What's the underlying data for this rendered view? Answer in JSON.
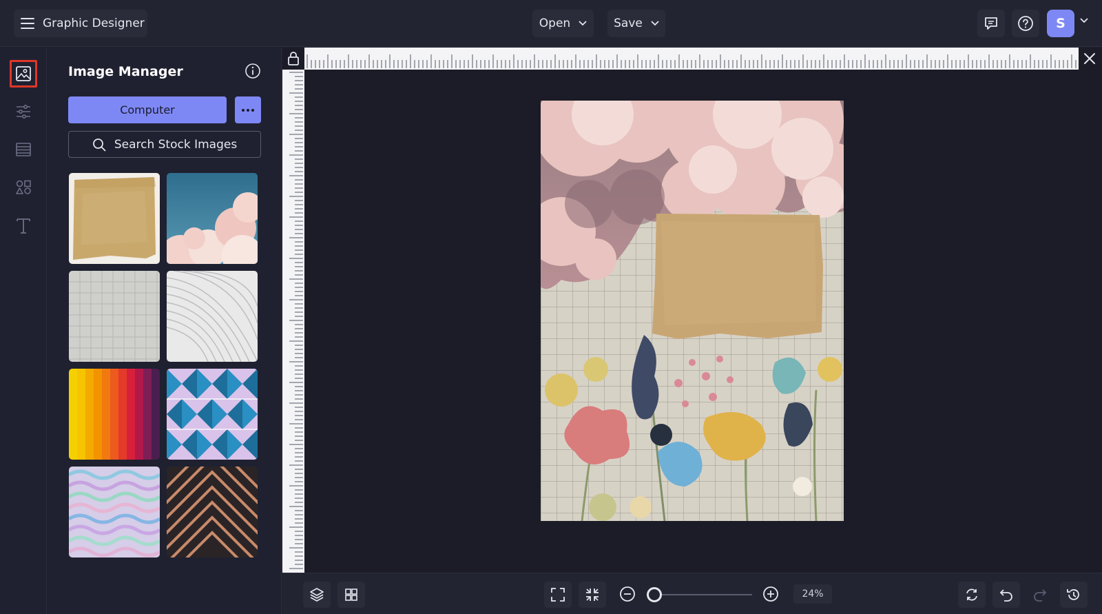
{
  "header": {
    "app_title": "Graphic Designer",
    "open_label": "Open",
    "save_label": "Save",
    "avatar_initial": "S"
  },
  "rail": {
    "items": [
      "image-manager",
      "adjustments",
      "layers-panel",
      "shapes",
      "text"
    ],
    "active": "image-manager"
  },
  "panel": {
    "title": "Image Manager",
    "computer_label": "Computer",
    "search_label": "Search Stock Images",
    "thumbnails": [
      "kraft paper texture",
      "pink clouds sky",
      "grid paper",
      "white curved lines",
      "rainbow stripes",
      "blue geometric triangles",
      "holographic waves",
      "copper chevron"
    ]
  },
  "bottom": {
    "zoom_value": "24%"
  },
  "colors": {
    "accent": "#7e88f5",
    "active_outline": "#e0362a",
    "background": "#1e1f2b"
  }
}
